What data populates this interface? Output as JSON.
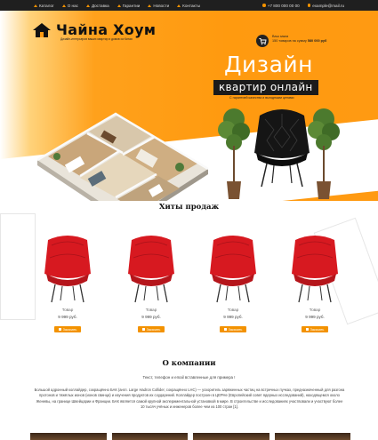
{
  "topbar": {
    "nav": [
      "Каталог",
      "О нас",
      "Доставка",
      "Гарантии",
      "Новости",
      "Контакты"
    ],
    "phone": "+7 800 000 00 00",
    "email": "example@mail.ru"
  },
  "brand": {
    "name": "Чайна Хоум",
    "tagline": "Дизайн-интерьеров ваших квартир и домов из Китая"
  },
  "cart": {
    "title": "Ваш заказ",
    "summary_prefix": "150 товаров на сумму",
    "summary_amount": "580 000 руб"
  },
  "hero": {
    "title": "Дизайн",
    "subtitle": "квартир онлайн",
    "note": "С гарантией качества и выгодными ценами"
  },
  "hits": {
    "title": "Хиты продаж",
    "products": [
      {
        "name": "Товар",
        "price": "9 999 руб.",
        "button": "Заказать"
      },
      {
        "name": "Товар",
        "price": "9 999 руб.",
        "button": "Заказать"
      },
      {
        "name": "Товар",
        "price": "9 999 руб.",
        "button": "Заказать"
      },
      {
        "name": "Товар",
        "price": "9 999 руб.",
        "button": "Заказать"
      }
    ]
  },
  "about": {
    "title": "О компании",
    "lead": "Текст, телефон и email вставленные для примера !",
    "text": "Большой адронный коллайдер, сокращённо БАК (англ. Large Hadron Collider, сокращённо LHC) — ускоритель заряженных частиц на встречных пучках, предназначенный для разгона протонов и тяжёлых ионов (ионов свинца) и изучения продуктов их соударений. Коллайдер построен в ЦЕРНе (Европейский совет ядерных исследований), находящемся около Женевы, на границе Швейцарии и Франции. БАК является самой крупной экспериментальной установкой в мире. В строительстве и исследованиях участвовали и участвуют более 10 тысяч учёных и инженеров более чем из 100 стран [1]."
  },
  "colors": {
    "accent": "#f39200",
    "dark": "#1f1f1f",
    "chair": "#d71920"
  },
  "icons": {
    "logo": "house-icon",
    "cart": "cart-icon",
    "phone": "phone-icon",
    "email": "email-icon"
  }
}
